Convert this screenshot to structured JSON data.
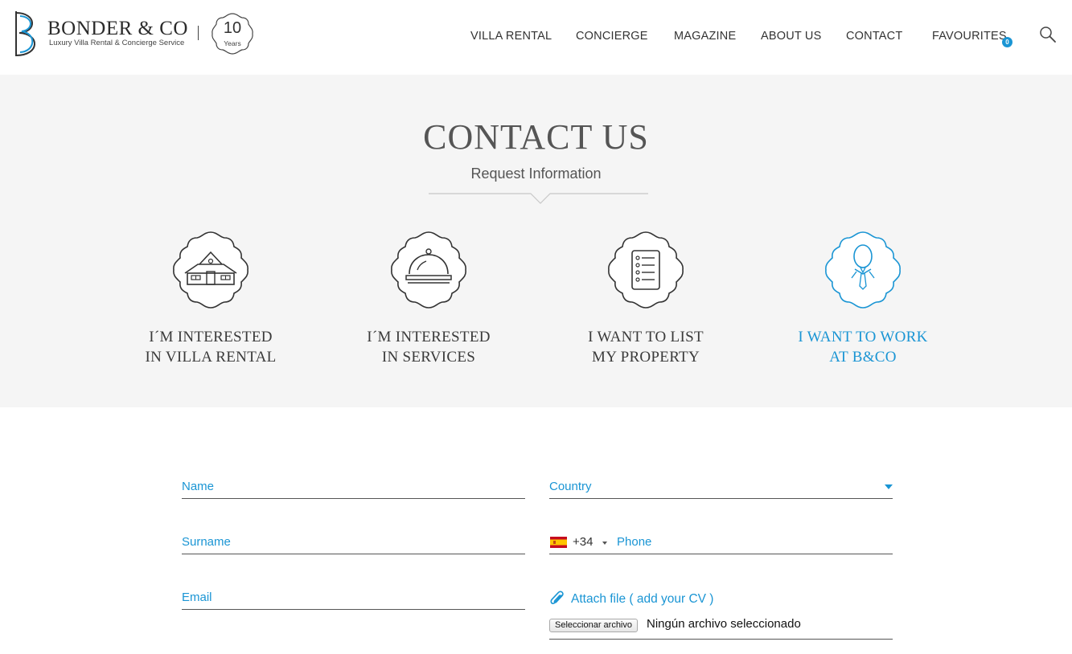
{
  "brand": {
    "name": "BONDER & CO",
    "tagline": "Luxury Villa Rental & Concierge Service",
    "badge_number": "10",
    "badge_text": "Years"
  },
  "nav": {
    "items": [
      "VILLA RENTAL",
      "CONCIERGE",
      "MAGAZINE",
      "ABOUT US",
      "CONTACT",
      "FAVOURITES"
    ],
    "favourites_count": "0"
  },
  "hero": {
    "title": "CONTACT US",
    "subtitle": "Request Information"
  },
  "options": [
    {
      "line1": "I´M INTERESTED",
      "line2": "IN VILLA RENTAL",
      "icon": "villa-house-icon"
    },
    {
      "line1": "I´M INTERESTED",
      "line2": "IN SERVICES",
      "icon": "service-cloche-icon"
    },
    {
      "line1": "I WANT TO LIST",
      "line2": "MY PROPERTY",
      "icon": "list-document-icon"
    },
    {
      "line1": "I WANT TO WORK",
      "line2": "AT B&CO",
      "icon": "person-tie-icon"
    }
  ],
  "form": {
    "name_placeholder": "Name",
    "surname_placeholder": "Surname",
    "email_placeholder": "Email",
    "country_placeholder": "Country",
    "phone_dial_code": "+34",
    "phone_placeholder": "Phone",
    "attach_label": "Attach file ( add your CV )",
    "file_button": "Seleccionar archivo",
    "file_status": "Ningún archivo seleccionado"
  },
  "colors": {
    "accent": "#1a95d4",
    "text": "#333333",
    "hero_bg": "#f5f5f5"
  }
}
